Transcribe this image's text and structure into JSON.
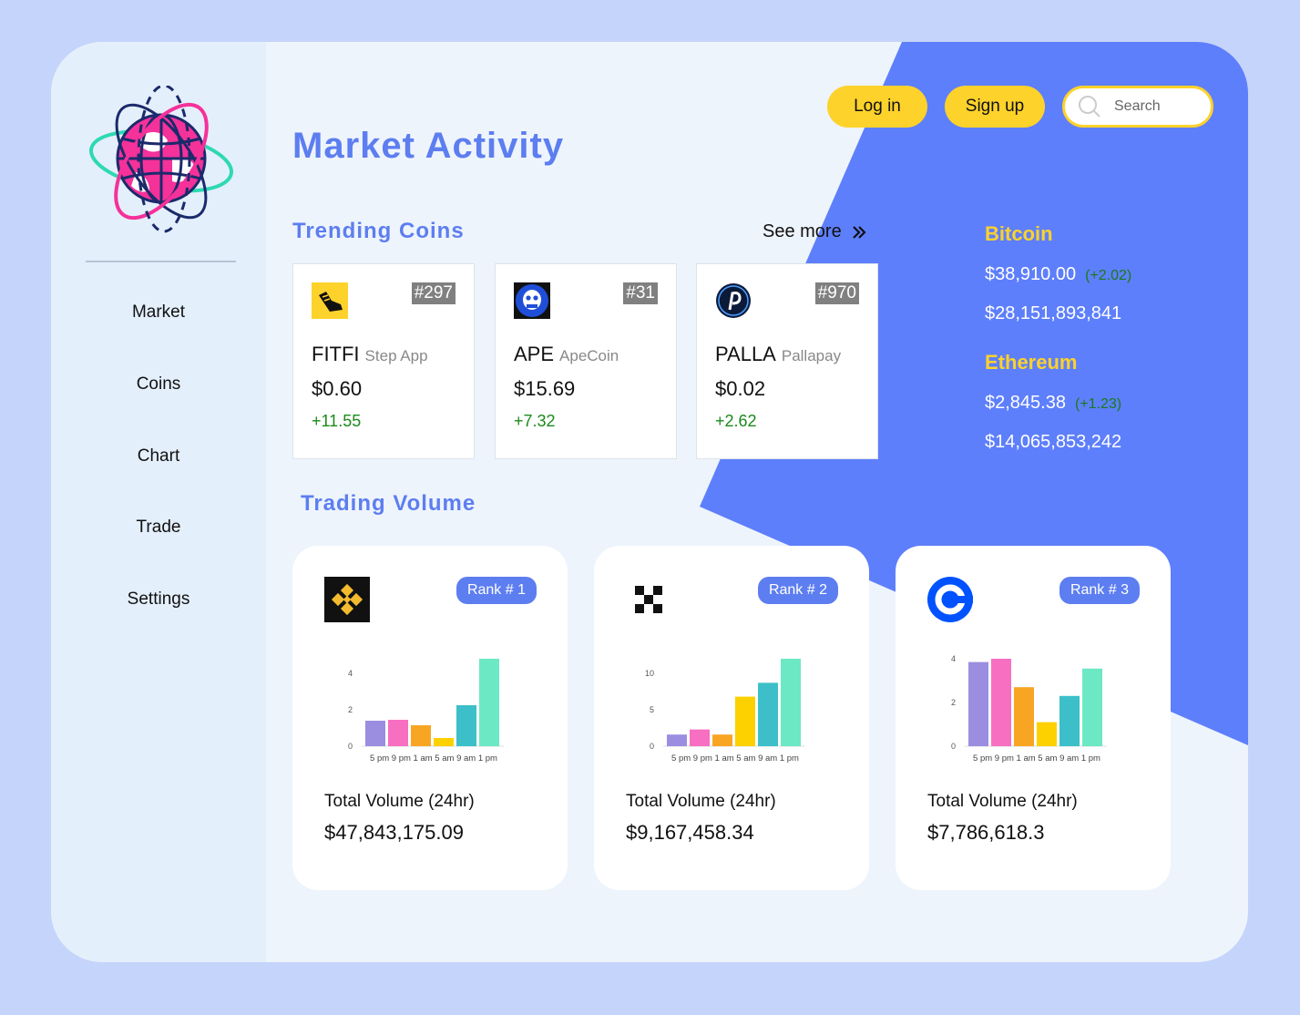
{
  "sidebar": {
    "nav": [
      "Market",
      "Coins",
      "Chart",
      "Trade",
      "Settings"
    ]
  },
  "header": {
    "title": "Market Activity",
    "login_label": "Log in",
    "signup_label": "Sign up",
    "search_placeholder": "Search"
  },
  "trending": {
    "title": "Trending Coins",
    "see_more": "See more",
    "coins": [
      {
        "icon": "fitfi-sneaker-icon",
        "rank": "#297",
        "symbol": "FITFI",
        "name": "Step App",
        "price": "$0.60",
        "change": "+11.55"
      },
      {
        "icon": "ape-skull-icon",
        "rank": "#31",
        "symbol": "APE",
        "name": "ApeCoin",
        "price": "$15.69",
        "change": "+7.32"
      },
      {
        "icon": "palla-p-icon",
        "rank": "#970",
        "symbol": "PALLA",
        "name": "Pallapay",
        "price": "$0.02",
        "change": "+2.62"
      }
    ]
  },
  "market_summary": [
    {
      "name": "Bitcoin",
      "price": "$38,910.00",
      "change": "(+2.02)",
      "volume": "$28,151,893,841"
    },
    {
      "name": "Ethereum",
      "price": "$2,845.38",
      "change": "(+1.23)",
      "volume": "$14,065,853,242"
    }
  ],
  "trading_volume": {
    "title": "Trading Volume",
    "exchanges": [
      {
        "icon": "binance-icon",
        "rank": "Rank # 1",
        "total_label": "Total Volume (24hr)",
        "total": "$47,843,175.09"
      },
      {
        "icon": "okx-icon",
        "rank": "Rank # 2",
        "total_label": "Total Volume (24hr)",
        "total": "$9,167,458.34"
      },
      {
        "icon": "coinbase-icon",
        "rank": "Rank # 3",
        "total_label": "Total Volume (24hr)",
        "total": "$7,786,618.3"
      }
    ]
  },
  "colors": {
    "accent": "#5d7ef0",
    "button": "#fdd22b",
    "positive": "#1a8a1a",
    "bars": [
      "#9b8ee0",
      "#f76fc0",
      "#f9a524",
      "#fdd000",
      "#3dbfc9",
      "#6ce8c4"
    ]
  },
  "chart_data": [
    {
      "type": "bar",
      "categories": [
        "5 pm",
        "9 pm",
        "1 am",
        "5 am",
        "9 am",
        "1 pm"
      ],
      "values": [
        1.4,
        1.45,
        1.15,
        0.45,
        2.25,
        4.8
      ],
      "yticks": [
        0,
        2,
        4
      ],
      "ylim": [
        0,
        4.8
      ]
    },
    {
      "type": "bar",
      "categories": [
        "5 pm",
        "9 pm",
        "1 am",
        "5 am",
        "9 am",
        "1 pm"
      ],
      "values": [
        1.6,
        2.3,
        1.6,
        6.8,
        8.7,
        12.0
      ],
      "yticks": [
        0,
        5,
        10
      ],
      "ylim": [
        0,
        12
      ]
    },
    {
      "type": "bar",
      "categories": [
        "5 pm",
        "9 pm",
        "1 am",
        "5 am",
        "9 am",
        "1 pm"
      ],
      "values": [
        3.85,
        4.0,
        2.7,
        1.1,
        2.3,
        3.55
      ],
      "yticks": [
        0,
        2,
        4
      ],
      "ylim": [
        0,
        4
      ]
    }
  ]
}
